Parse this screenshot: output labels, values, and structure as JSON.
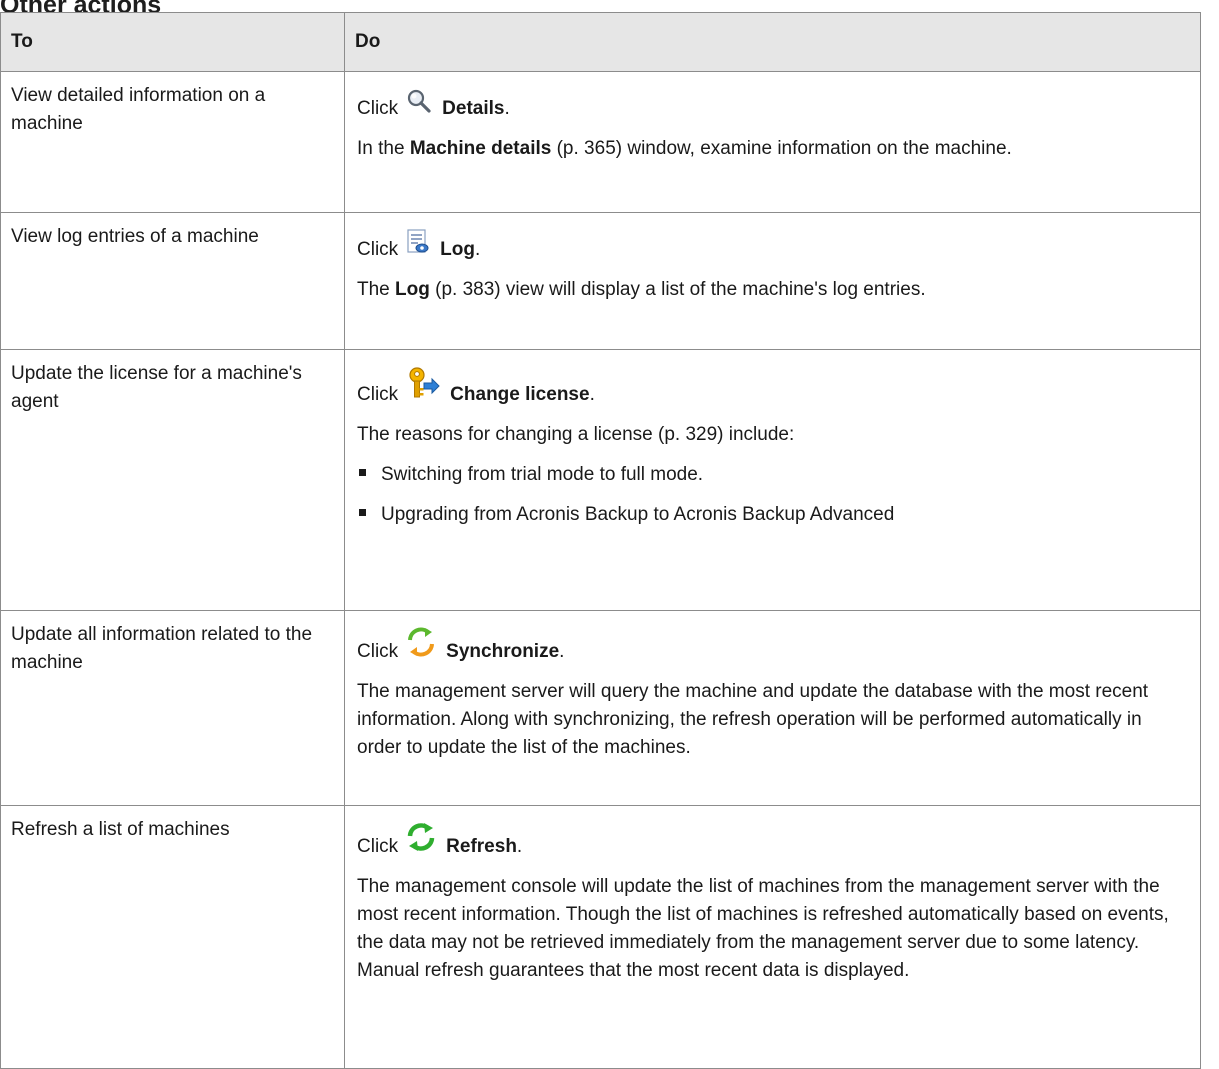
{
  "section_heading": "Other actions",
  "table": {
    "col_to": "To",
    "col_do": "Do"
  },
  "rows": [
    {
      "to": "View detailed information on a machine",
      "click_word": "Click",
      "action": "Details",
      "icon": "magnifier-icon",
      "desc_pre": "In the",
      "desc_bold": "Machine details",
      "desc_post": "(p. 365) window, examine information on the machine."
    },
    {
      "to": "View log entries of a machine",
      "click_word": "Click",
      "action": "Log",
      "icon": "log-icon",
      "desc_pre": "The",
      "desc_bold": "Log",
      "desc_post": "(p. 383) view will display a list of the machine's log entries."
    },
    {
      "to": "Update the license for a machine's agent",
      "click_word": "Click",
      "action": "Change license",
      "icon": "key-arrow-icon",
      "desc": "The reasons for changing a license (p. 329) include:",
      "bullets": [
        "Switching from trial mode to full mode.",
        "Upgrading from Acronis Backup to Acronis Backup Advanced"
      ]
    },
    {
      "to": "Update all information related to the machine",
      "click_word": "Click",
      "action": "Synchronize",
      "icon": "synchronize-icon",
      "desc": "The management server will query the machine and update the database with the most recent information. Along with synchronizing, the refresh operation will be performed automatically in order to update the list of the machines."
    },
    {
      "to": "Refresh a list of machines",
      "click_word": "Click",
      "action": "Refresh",
      "icon": "refresh-icon",
      "desc": "The management console will update the list of machines from the management server with the most recent information. Though the list of machines is refreshed automatically based on events, the data may not be retrieved immediately from the management server due to some latency. Manual refresh guarantees that the most recent data is displayed."
    }
  ]
}
